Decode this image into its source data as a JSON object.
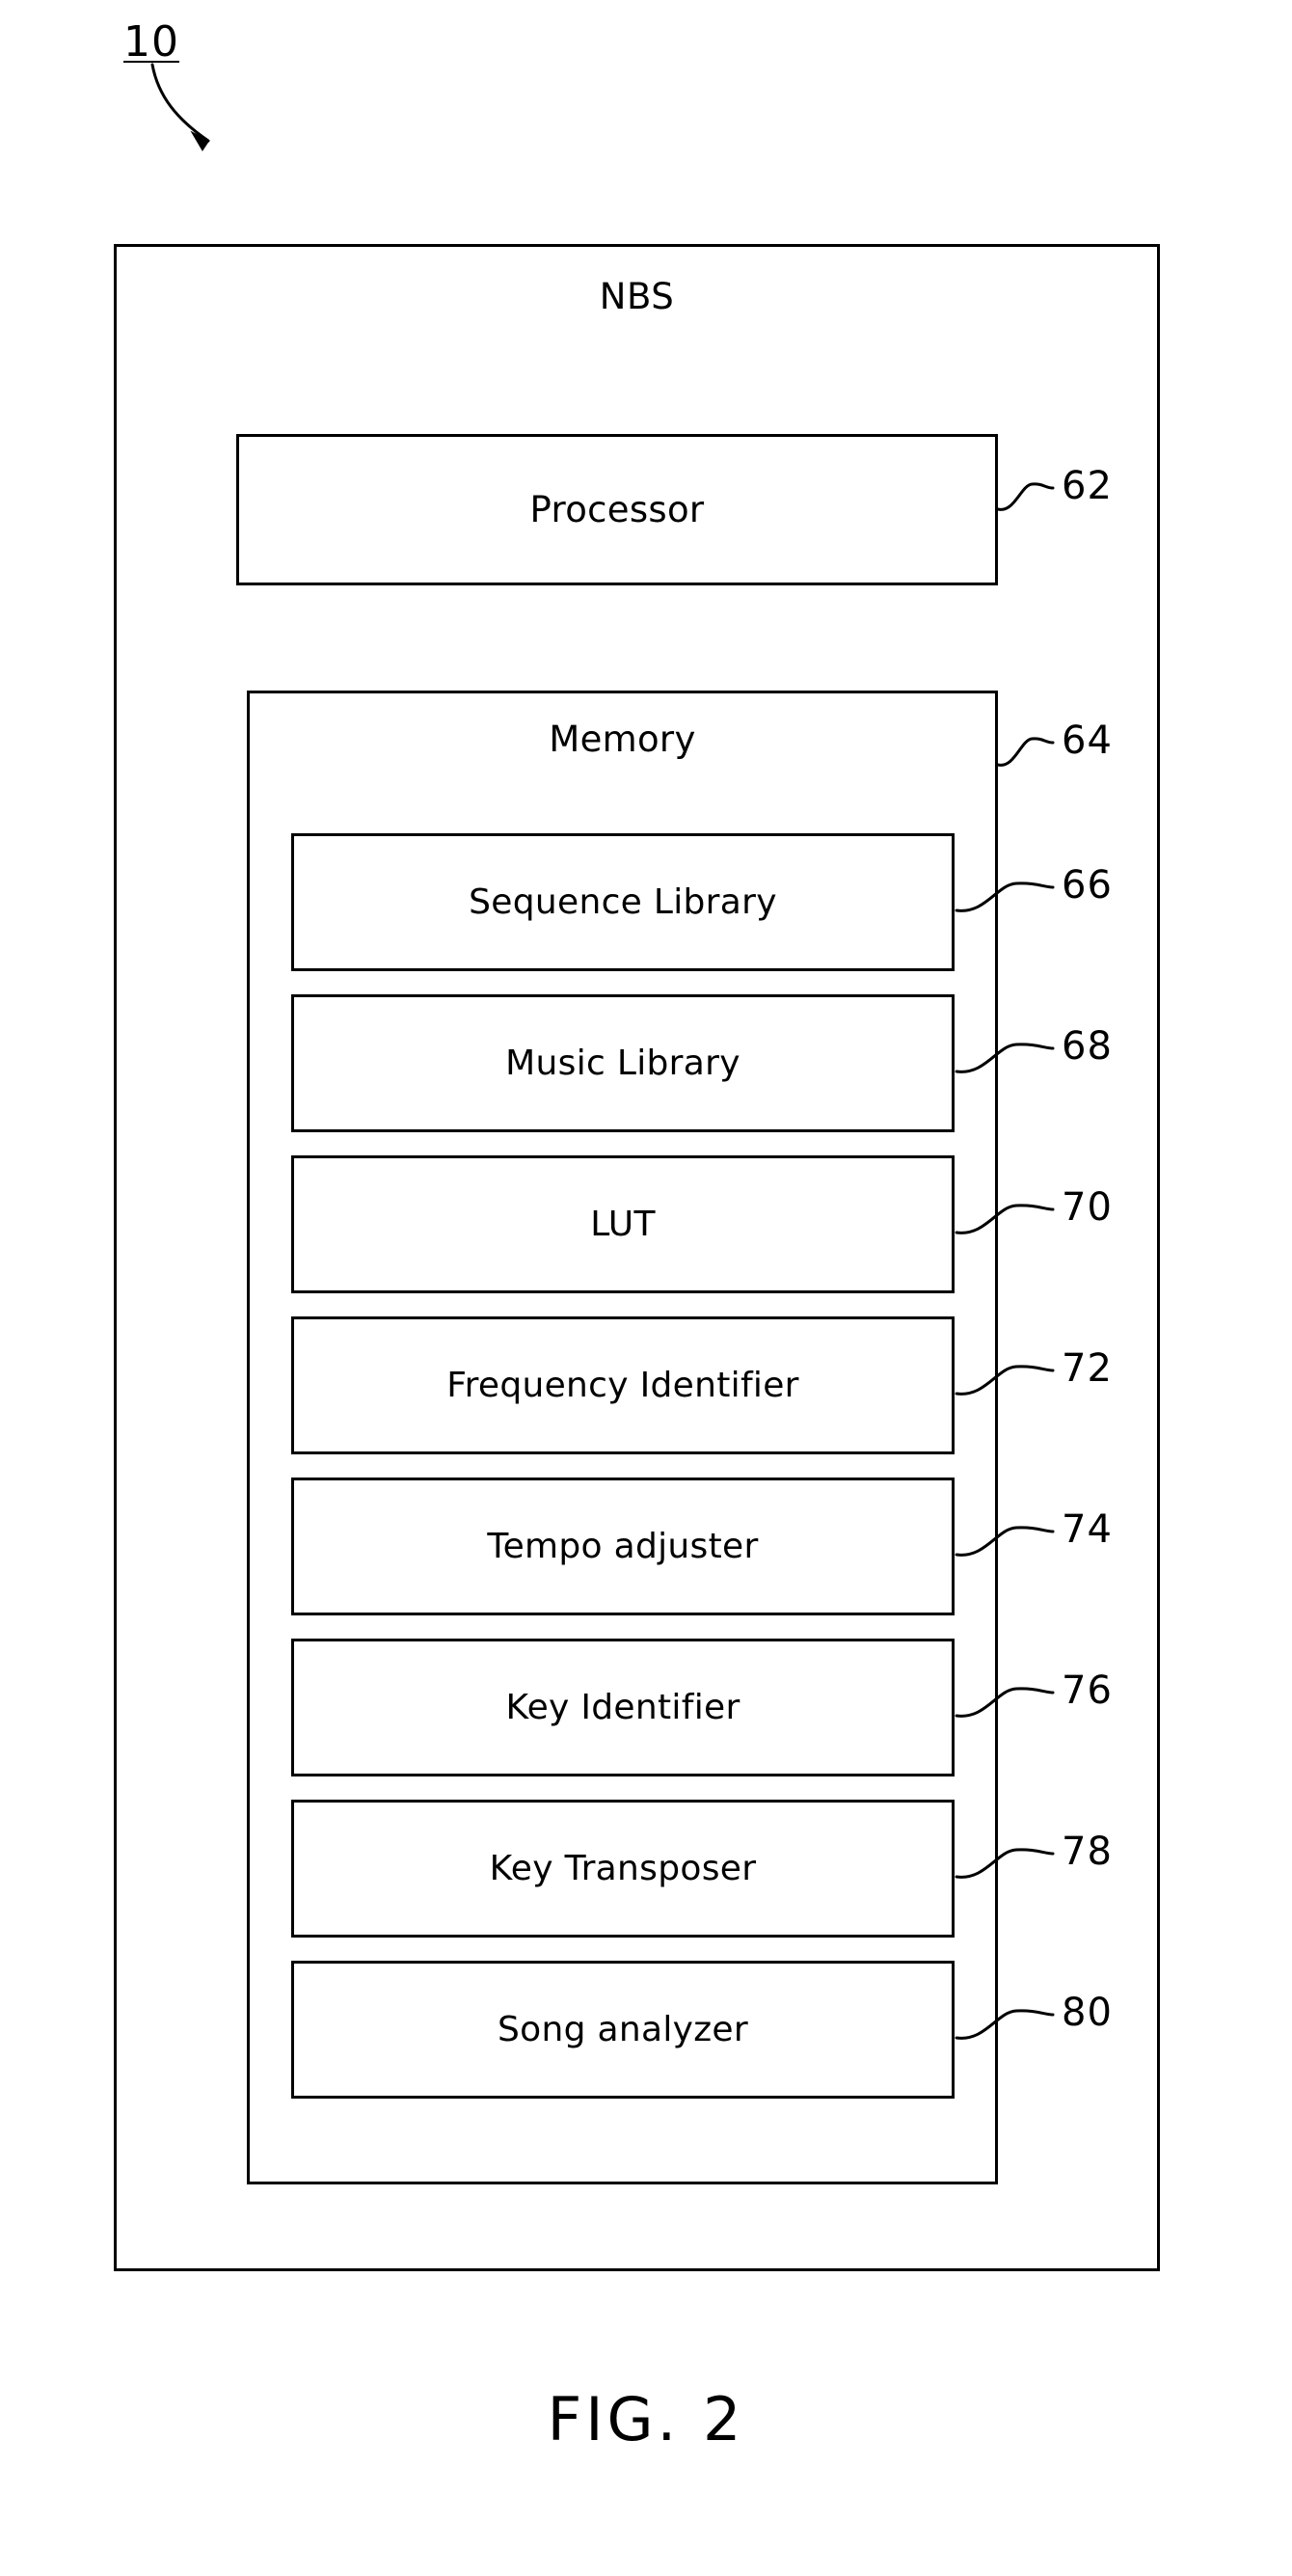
{
  "figure": {
    "caption": "FIG. 2",
    "system_reference": "10"
  },
  "outer_block": {
    "title": "NBS"
  },
  "processor": {
    "label": "Processor",
    "ref": "62"
  },
  "memory": {
    "label": "Memory",
    "ref": "64",
    "modules": [
      {
        "label": "Sequence Library",
        "ref": "66"
      },
      {
        "label": "Music Library",
        "ref": "68"
      },
      {
        "label": "LUT",
        "ref": "70"
      },
      {
        "label": "Frequency Identifier",
        "ref": "72"
      },
      {
        "label": "Tempo adjuster",
        "ref": "74"
      },
      {
        "label": "Key Identifier",
        "ref": "76"
      },
      {
        "label": "Key Transposer",
        "ref": "78"
      },
      {
        "label": "Song analyzer",
        "ref": "80"
      }
    ]
  },
  "style": {
    "line_color": "#000000",
    "background_color": "#ffffff"
  }
}
